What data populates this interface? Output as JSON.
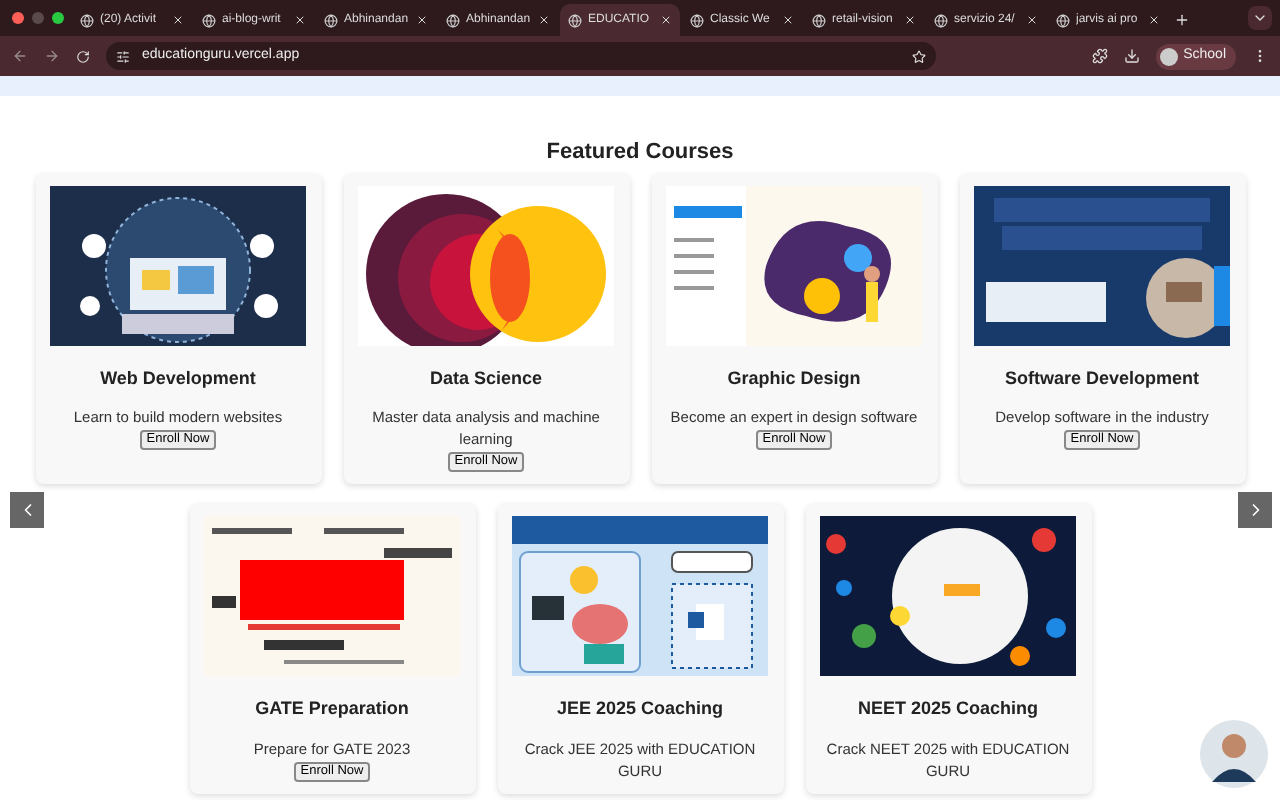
{
  "browser": {
    "tabs": [
      {
        "title": "(20) Activit",
        "selected": false
      },
      {
        "title": "ai-blog-writ",
        "selected": false
      },
      {
        "title": "Abhinandan",
        "selected": false
      },
      {
        "title": "Abhinandan",
        "selected": false
      },
      {
        "title": "EDUCATIO",
        "selected": true
      },
      {
        "title": "Classic We",
        "selected": false
      },
      {
        "title": "retail-vision",
        "selected": false
      },
      {
        "title": "servizio 24/",
        "selected": false
      },
      {
        "title": "jarvis ai pro",
        "selected": false
      }
    ],
    "url": "educationguru.vercel.app",
    "profile": "School"
  },
  "page": {
    "heading": "Featured Courses",
    "rows": [
      [
        {
          "title": "Web Development",
          "description": "Learn to build modern websites",
          "button": "Enroll Now"
        },
        {
          "title": "Data Science",
          "description": "Master data analysis and machine learning",
          "button": "Enroll Now"
        },
        {
          "title": "Graphic Design",
          "description": "Become an expert in design software",
          "button": "Enroll Now"
        },
        {
          "title": "Software Development",
          "description": "Develop software in the industry",
          "button": "Enroll Now"
        }
      ],
      [
        {
          "title": "GATE Preparation",
          "description": "Prepare for GATE 2023",
          "button": "Enroll Now"
        },
        {
          "title": "JEE 2025 Coaching",
          "description": "Crack JEE 2025 with EDUCATION GURU"
        },
        {
          "title": "NEET 2025 Coaching",
          "description": "Crack NEET 2025 with EDUCATION GURU"
        }
      ]
    ]
  }
}
